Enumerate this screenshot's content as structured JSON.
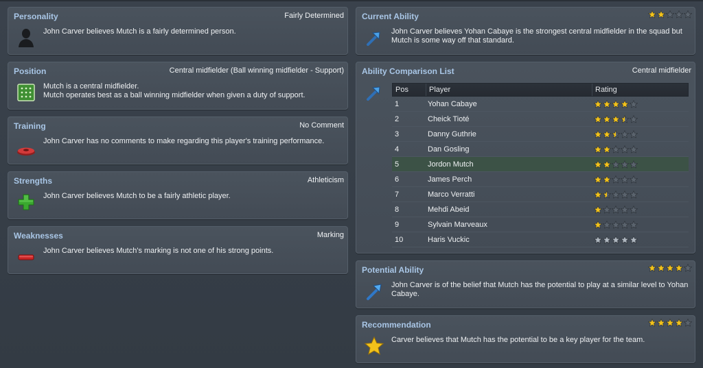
{
  "personality": {
    "title": "Personality",
    "value": "Fairly Determined",
    "icon": "head-silhouette-icon",
    "text": "John Carver believes Mutch is a fairly determined person."
  },
  "position": {
    "title": "Position",
    "value": "Central midfielder (Ball winning midfielder - Support)",
    "icon": "pitch-icon",
    "text_line1": "Mutch is a central midfielder.",
    "text_line2": "Mutch operates best as a ball winning midfielder when given a duty of support."
  },
  "training": {
    "title": "Training",
    "value": "No Comment",
    "icon": "training-cone-icon",
    "text": "John Carver has no comments to make regarding this player's training performance."
  },
  "strengths": {
    "title": "Strengths",
    "value": "Athleticism",
    "icon": "plus-icon",
    "text": "John Carver believes Mutch to be a fairly athletic player."
  },
  "weaknesses": {
    "title": "Weaknesses",
    "value": "Marking",
    "icon": "minus-icon",
    "text": "John Carver believes Mutch's marking is not one of his strong points."
  },
  "current_ability": {
    "title": "Current Ability",
    "stars": 2,
    "icon": "arrow-icon",
    "text_line1": "John Carver believes Yohan Cabaye is the strongest central midfielder in the squad but",
    "text_line2": "Mutch is some way off that standard."
  },
  "comparison": {
    "title": "Ability Comparison List",
    "value": "Central midfielder",
    "icon": "arrow-icon",
    "headers": {
      "pos": "Pos",
      "player": "Player",
      "rating": "Rating"
    },
    "rows": [
      {
        "pos": "1",
        "player": "Yohan Cabaye",
        "rating": 4,
        "highlight": false,
        "grey": false
      },
      {
        "pos": "2",
        "player": "Cheick Tioté",
        "rating": 3.5,
        "highlight": false,
        "grey": false
      },
      {
        "pos": "3",
        "player": "Danny Guthrie",
        "rating": 2.5,
        "highlight": false,
        "grey": false
      },
      {
        "pos": "4",
        "player": "Dan Gosling",
        "rating": 2,
        "highlight": false,
        "grey": false
      },
      {
        "pos": "5",
        "player": "Jordon Mutch",
        "rating": 2,
        "highlight": true,
        "grey": false
      },
      {
        "pos": "6",
        "player": "James Perch",
        "rating": 2,
        "highlight": false,
        "grey": false
      },
      {
        "pos": "7",
        "player": "Marco Verratti",
        "rating": 1.5,
        "highlight": false,
        "grey": false
      },
      {
        "pos": "8",
        "player": "Mehdi Abeid",
        "rating": 1,
        "highlight": false,
        "grey": false
      },
      {
        "pos": "9",
        "player": "Sylvain Marveaux",
        "rating": 1,
        "highlight": false,
        "grey": false
      },
      {
        "pos": "10",
        "player": "Haris Vuckic",
        "rating": 5,
        "highlight": false,
        "grey": true
      }
    ]
  },
  "potential_ability": {
    "title": "Potential Ability",
    "stars": 4,
    "icon": "arrow-up-icon",
    "text_line1": "John Carver is of the belief that Mutch has the potential to play at a similar level to Yohan",
    "text_line2": "Cabaye."
  },
  "recommendation": {
    "title": "Recommendation",
    "stars": 4,
    "icon": "gold-star-icon",
    "text": "Carver believes that Mutch has the potential to be a key player for the team."
  },
  "colors": {
    "title_blue": "#a9c6e6",
    "star_gold": "#f2c21b",
    "star_empty": "#5a636d",
    "star_grey": "#aeb6bf",
    "highlight_row": "#3c5246"
  }
}
